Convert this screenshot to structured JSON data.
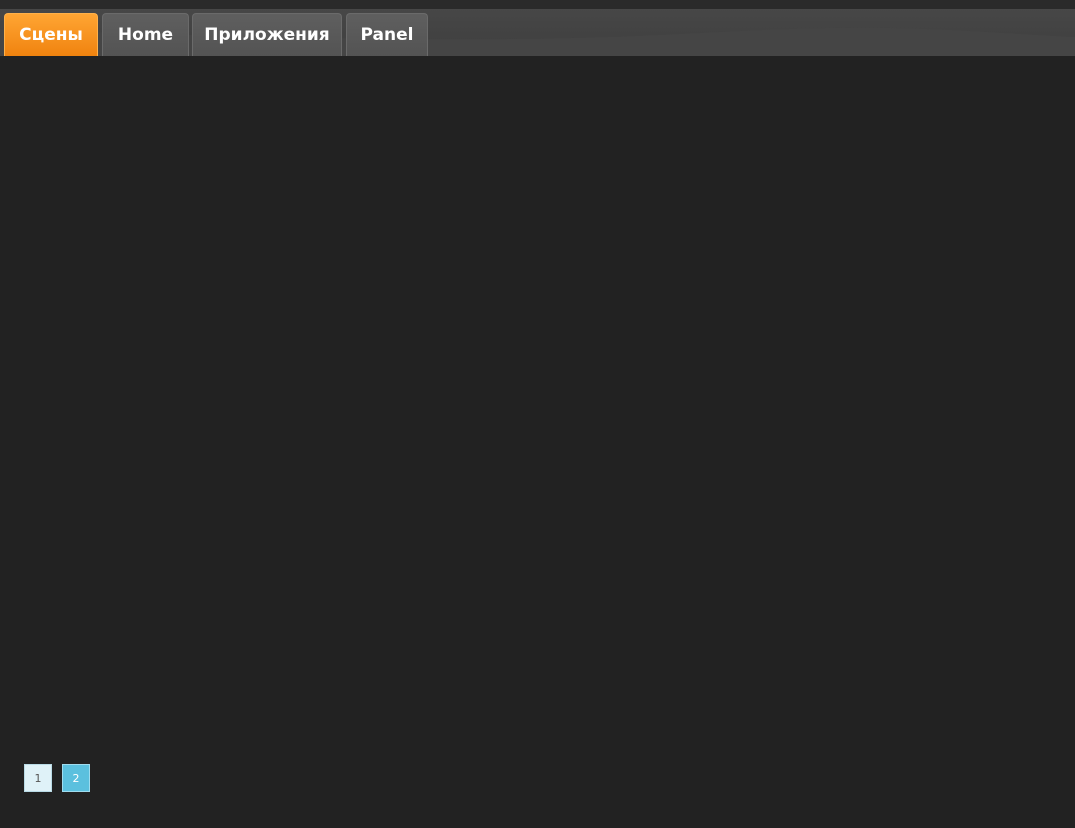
{
  "tabs": [
    {
      "label": "Сцены",
      "active": true
    },
    {
      "label": "Home",
      "active": false
    },
    {
      "label": "Приложения",
      "active": false
    },
    {
      "label": "Panel",
      "active": false
    }
  ],
  "pagination": {
    "pages": [
      "1",
      "2"
    ],
    "current": "2"
  },
  "colors": {
    "background": "#222222",
    "active_tab": "#f7931e",
    "tab": "#595959",
    "current_page": "#5bc0de",
    "page": "#dff2f8"
  }
}
